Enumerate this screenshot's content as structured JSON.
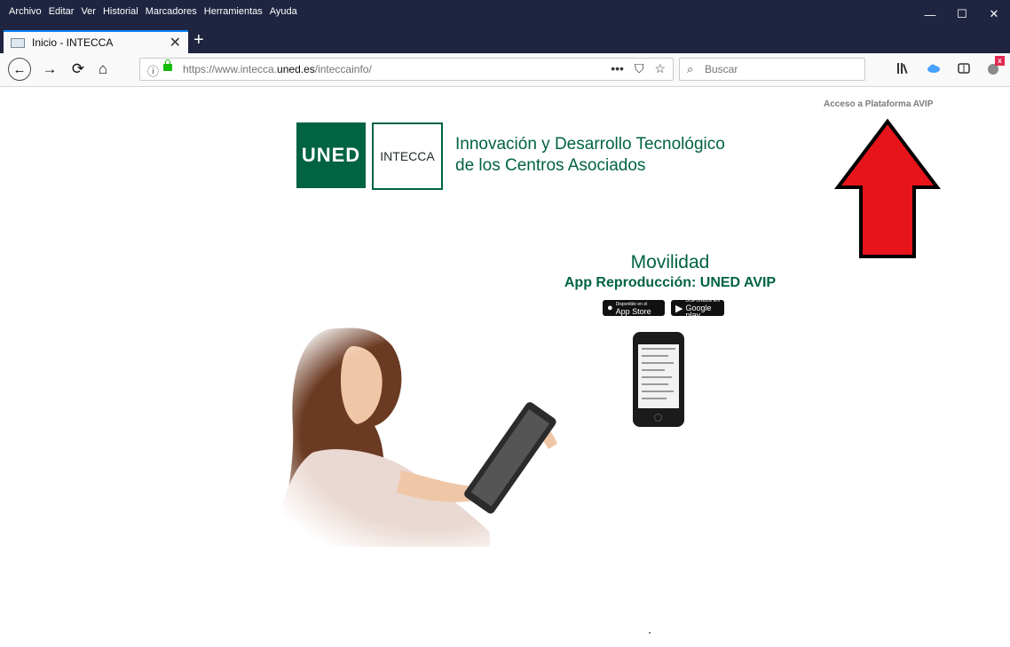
{
  "browser": {
    "menu": [
      "Archivo",
      "Editar",
      "Ver",
      "Historial",
      "Marcadores",
      "Herramientas",
      "Ayuda"
    ],
    "window_controls": {
      "minimize": "—",
      "maximize": "☐",
      "close": "✕"
    },
    "tab": {
      "title": "Inicio - INTECCA",
      "close": "✕"
    },
    "new_tab": "+",
    "nav": {
      "back": "←",
      "forward": "→",
      "reload": "⟳",
      "home": "⌂"
    },
    "url": {
      "prefix": "https://www.intecca.",
      "domain": "uned.es",
      "path": "/inteccainfo/"
    },
    "url_actions": {
      "more": "•••",
      "pocket": "⛉",
      "bookmark": "☆"
    },
    "search": {
      "placeholder": "Buscar"
    },
    "toolbar_icons": [
      "library-icon",
      "cloud-icon",
      "reader-icon",
      "extension-icon"
    ],
    "extension_badge": "x"
  },
  "page": {
    "access_link": "Acceso a Plataforma AVIP",
    "logo_uned": "UNED",
    "logo_intecca": "INTECCA",
    "tagline_line1": "Innovación y Desarrollo Tecnológico",
    "tagline_line2": "de los Centros Asociados",
    "movilidad": "Movilidad",
    "app_title": "App Reproducción: UNED AVIP",
    "appstore": {
      "small": "Disponible en el",
      "big": "App Store"
    },
    "googleplay": {
      "small": "DISPONIBLE EN",
      "big": "Google play"
    }
  },
  "colors": {
    "brand_green": "#006341",
    "chrome_dark": "#1f2440",
    "annotation_red": "#e8141b"
  }
}
